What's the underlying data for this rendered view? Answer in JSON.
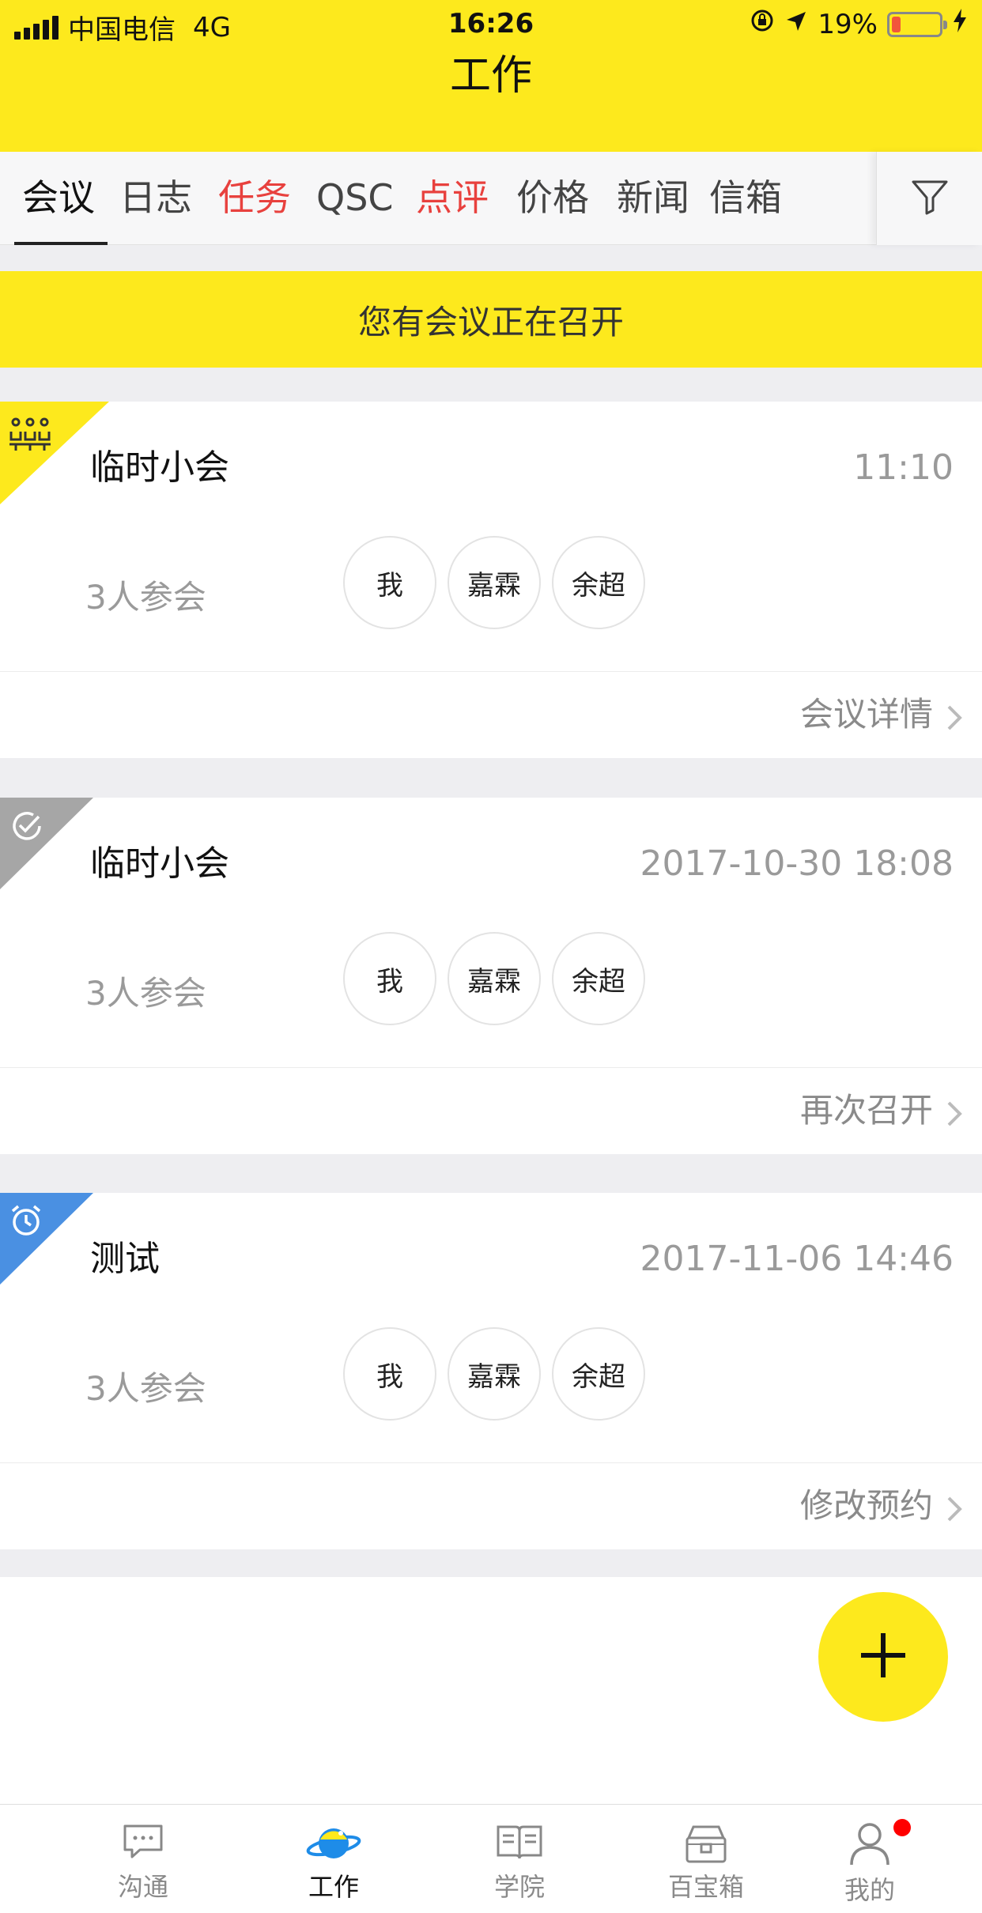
{
  "status_bar": {
    "carrier": "中国电信",
    "network": "4G",
    "time": "16:26",
    "battery_percent": "19%",
    "battery_level": 0.19
  },
  "header": {
    "title": "工作"
  },
  "tabs": [
    {
      "label": "会议",
      "active": true,
      "color": "#111111"
    },
    {
      "label": "日志",
      "color": "#444444"
    },
    {
      "label": "任务",
      "color": "#e8413e"
    },
    {
      "label": "QSC",
      "color": "#444444"
    },
    {
      "label": "点评",
      "color": "#e8413e"
    },
    {
      "label": "价格",
      "color": "#444444"
    },
    {
      "label": "新闻",
      "color": "#444444"
    },
    {
      "label": "信箱",
      "color": "#444444"
    }
  ],
  "banner": {
    "text": "您有会议正在召开"
  },
  "meetings": [
    {
      "status_icon": "meeting-people-icon",
      "corner_color": "#fde91d",
      "title": "临时小会",
      "time": "11:10",
      "attendee_count": "3人参会",
      "attendees": [
        "我",
        "嘉霖",
        "余超"
      ],
      "action": "会议详情"
    },
    {
      "status_icon": "check-circle-icon",
      "corner_color": "#a6a6a6",
      "title": "临时小会",
      "time": "2017-10-30 18:08",
      "attendee_count": "3人参会",
      "attendees": [
        "我",
        "嘉霖",
        "余超"
      ],
      "action": "再次召开"
    },
    {
      "status_icon": "alarm-clock-icon",
      "corner_color": "#4a90e2",
      "title": "测试",
      "time": "2017-11-06 14:46",
      "attendee_count": "3人参会",
      "attendees": [
        "我",
        "嘉霖",
        "余超"
      ],
      "action": "修改预约"
    }
  ],
  "tabbar": [
    {
      "label": "沟通",
      "icon": "chat-bubble-icon"
    },
    {
      "label": "工作",
      "icon": "planet-icon",
      "active": true
    },
    {
      "label": "学院",
      "icon": "open-book-icon"
    },
    {
      "label": "百宝箱",
      "icon": "treasure-box-icon"
    },
    {
      "label": "我的",
      "icon": "person-icon",
      "has_badge": true
    }
  ]
}
